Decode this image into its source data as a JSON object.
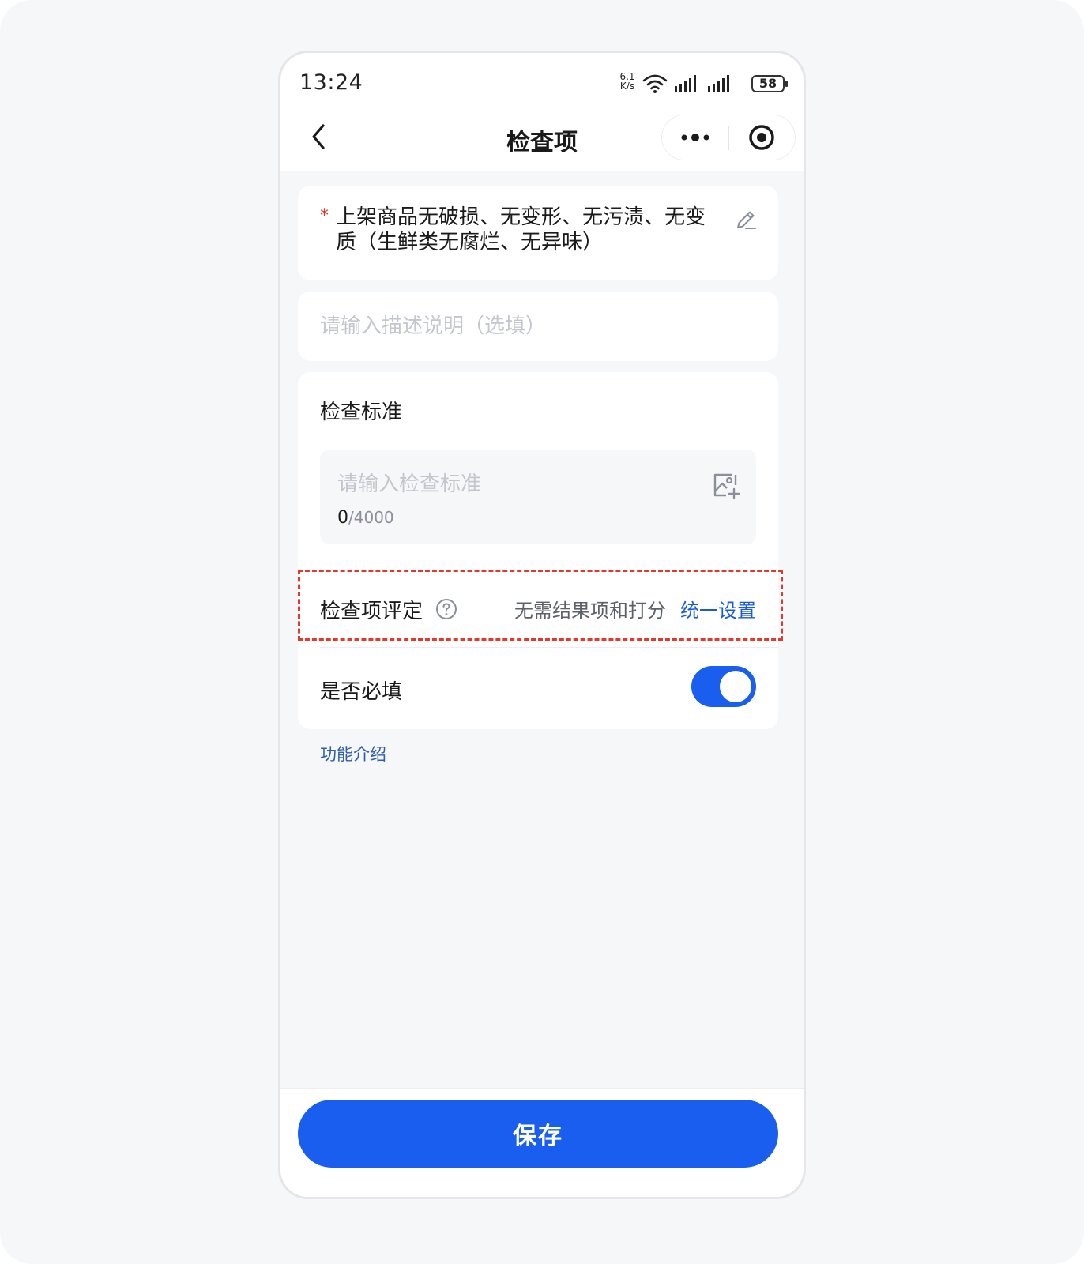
{
  "status_bar": {
    "time": "13:24",
    "network_speed_value": "6.1",
    "network_speed_unit": "K/s",
    "battery": "58"
  },
  "nav": {
    "title": "检查项",
    "back_icon": "chevron-left-icon",
    "more_icon": "more-dots-icon",
    "close_icon": "target-close-icon"
  },
  "item": {
    "required_mark": "*",
    "title": "上架商品无破损、无变形、无污渍、无变质（生鲜类无腐烂、无异味）"
  },
  "description": {
    "placeholder": "请输入描述说明（选填）",
    "value": ""
  },
  "standard": {
    "label": "检查标准",
    "placeholder": "请输入检查标准",
    "count": "0",
    "max": "/4000"
  },
  "rating": {
    "label": "检查项评定",
    "value": "无需结果项和打分",
    "action": "统一设置"
  },
  "required_toggle": {
    "label": "是否必填",
    "on": true
  },
  "feature_intro": "功能介绍",
  "footer": {
    "save_label": "保存"
  },
  "colors": {
    "accent": "#1a5ef0",
    "link": "#1a5bd7",
    "required": "#e5382d",
    "highlight_border": "#e5382d"
  }
}
